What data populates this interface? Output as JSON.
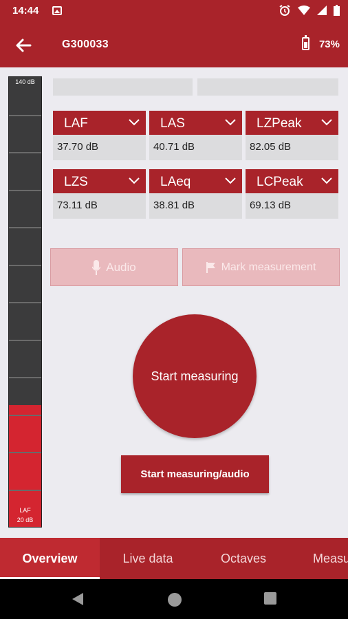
{
  "status_bar": {
    "time": "14:44"
  },
  "app_bar": {
    "title": "G300033",
    "battery": "73%"
  },
  "meter": {
    "top_label": "140 dB",
    "bottom_label": "LAF",
    "bottom_value": "20 dB",
    "level_fraction": 0.27
  },
  "cards": [
    {
      "label": "LAF",
      "value": "37.70 dB"
    },
    {
      "label": "LAS",
      "value": "40.71 dB"
    },
    {
      "label": "LZPeak",
      "value": "82.05 dB"
    },
    {
      "label": "LZS",
      "value": "73.11 dB"
    },
    {
      "label": "LAeq",
      "value": "38.81 dB"
    },
    {
      "label": "LCPeak",
      "value": "69.13 dB"
    }
  ],
  "buttons": {
    "audio": "Audio",
    "mark": "Mark measurement",
    "start": "Start measuring",
    "start_audio": "Start measuring/audio"
  },
  "tabs": [
    "Overview",
    "Live data",
    "Octaves",
    "Measu"
  ],
  "colors": {
    "primary": "#a9232a",
    "meter_fill": "#d42530",
    "background": "#ecebf0"
  },
  "icons": [
    "back-arrow-icon",
    "battery-icon",
    "alarm-icon",
    "wifi-icon",
    "signal-icon",
    "mic-icon",
    "flag-icon",
    "chevron-down-icon"
  ]
}
